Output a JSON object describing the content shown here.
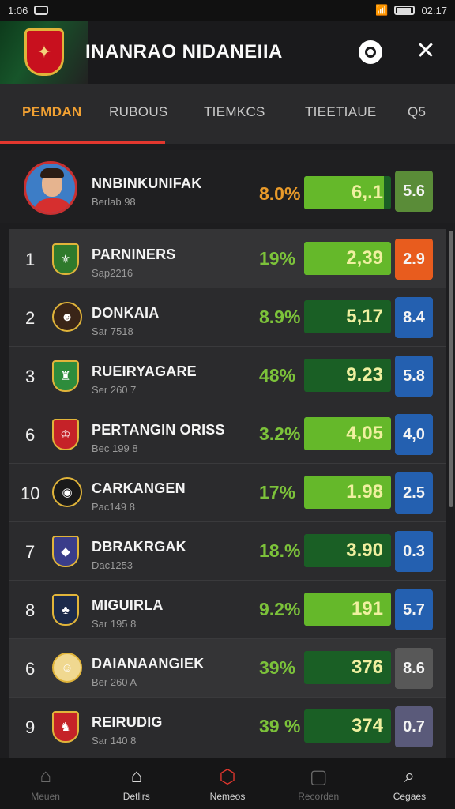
{
  "status_bar": {
    "time": "1:06",
    "clock": "02:17"
  },
  "header": {
    "title": "INANRAO NIDANEIIA",
    "search_icon": "search-icon",
    "close_icon": "close-icon"
  },
  "tabs": [
    "PEMDAN",
    "RUBOUS",
    "TIEMKCS",
    "TIEETIAUE",
    "Q5"
  ],
  "player": {
    "name": "NNBINKUNIFAK",
    "sub": "Berlab 98",
    "percent": "8.0%",
    "bar_value": "6,.1",
    "bar_fill": 0.92,
    "score": "5.6",
    "score_color": "#5a8c38"
  },
  "rows": [
    {
      "rank": "1",
      "name": "PARNINERS",
      "sub": "Sap2216",
      "percent": "19%",
      "bar_value": "2,39",
      "bar_fill": 1.0,
      "score": "2.9",
      "score_color": "#e85c1e",
      "badge_color": "#2f7a2c",
      "badge_glyph": "⚜"
    },
    {
      "rank": "2",
      "name": "DONKAIA",
      "sub": "Sar 7518",
      "percent": "8.9%",
      "bar_value": "5,17",
      "bar_fill": 0.0,
      "score": "8.4",
      "score_color": "#2460b0",
      "badge_color": "#3a2518",
      "badge_glyph": "☻"
    },
    {
      "rank": "3",
      "name": "RUEIRYAGARE",
      "sub": "Ser 260 7",
      "percent": "48%",
      "bar_value": "9.23",
      "bar_fill": 0.0,
      "score": "5.8",
      "score_color": "#2460b0",
      "badge_color": "#2e8c3c",
      "badge_glyph": "♜"
    },
    {
      "rank": "6",
      "name": "PERTANGIN ORISS",
      "sub": "Bec 199 8",
      "percent": "3.2%",
      "bar_value": "4,05",
      "bar_fill": 1.0,
      "score": "4,0",
      "score_color": "#2460b0",
      "badge_color": "#c52228",
      "badge_glyph": "♔"
    },
    {
      "rank": "10",
      "name": "CARKANGEN",
      "sub": "Pac149 8",
      "percent": "17%",
      "bar_value": "1.98",
      "bar_fill": 1.0,
      "score": "2.5",
      "score_color": "#2460b0",
      "badge_color": "#1a1a1a",
      "badge_glyph": "◉"
    },
    {
      "rank": "7",
      "name": "DBRAKRGAK",
      "sub": "Dac1253",
      "percent": "18.%",
      "bar_value": "3.90",
      "bar_fill": 0.0,
      "score": "0.3",
      "score_color": "#2460b0",
      "badge_color": "#3a3d8a",
      "badge_glyph": "◆"
    },
    {
      "rank": "8",
      "name": "MIGUIRLA",
      "sub": "Sar 195 8",
      "percent": "9.2%",
      "bar_value": "191",
      "bar_fill": 1.0,
      "score": "5.7",
      "score_color": "#2460b0",
      "badge_color": "#1c2a4a",
      "badge_glyph": "♣"
    },
    {
      "rank": "6",
      "name": "DAIANAANGIEK",
      "sub": "Ber 260 A",
      "percent": "39%",
      "bar_value": "376",
      "bar_fill": 0.0,
      "score": "8.6",
      "score_color": "#585858",
      "badge_color": "#f0d890",
      "badge_glyph": "☺"
    },
    {
      "rank": "9",
      "name": "REIRUDIG",
      "sub": "Sar 140 8",
      "percent": "39 %",
      "bar_value": "374",
      "bar_fill": 0.0,
      "score": "0.7",
      "score_color": "#5a5a7a",
      "badge_color": "#c52228",
      "badge_glyph": "♞"
    }
  ],
  "bottom_nav": [
    {
      "label": "Meuen",
      "icon": "home-icon"
    },
    {
      "label": "Detlirs",
      "icon": "house-outline-icon"
    },
    {
      "label": "Nemeos",
      "icon": "badge-icon"
    },
    {
      "label": "Recorden",
      "icon": "edit-icon"
    },
    {
      "label": "Cegaes",
      "icon": "search-icon"
    }
  ]
}
